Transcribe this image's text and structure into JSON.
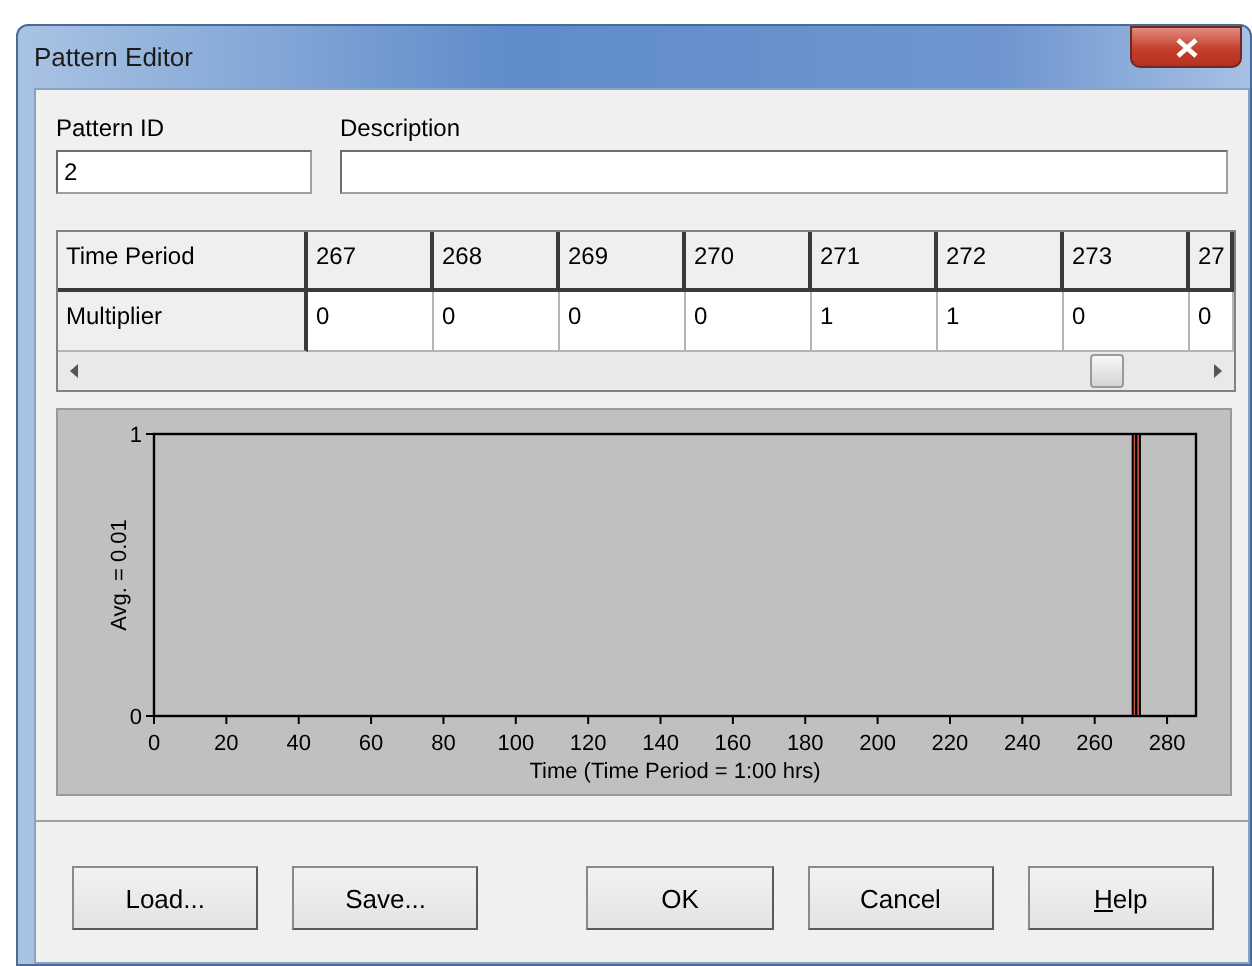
{
  "window": {
    "title": "Pattern Editor"
  },
  "pattern_id": {
    "label": "Pattern ID",
    "value": "2"
  },
  "description": {
    "label": "Description"
  },
  "grid": {
    "row_labels": [
      "Time Period",
      "Multiplier"
    ],
    "periods": [
      "267",
      "268",
      "269",
      "270",
      "271",
      "272",
      "273",
      "27"
    ],
    "multipliers": [
      "0",
      "0",
      "0",
      "0",
      "1",
      "1",
      "0",
      "0"
    ]
  },
  "chart": {
    "chart_data": {
      "type": "bar",
      "xlabel": "Time (Time Period = 1:00 hrs)",
      "ylabel": "Avg. = 0.01",
      "x": [
        271,
        272
      ],
      "series": [
        {
          "color": "#c8553d",
          "values": [
            1,
            1
          ]
        }
      ],
      "xlim": [
        0,
        288
      ],
      "ylim": [
        0,
        1
      ],
      "xticks": [
        0,
        20,
        40,
        60,
        80,
        100,
        120,
        140,
        160,
        180,
        200,
        220,
        240,
        260,
        280
      ],
      "yticks": [
        0,
        1
      ]
    }
  },
  "buttons": [
    {
      "label": "Load..."
    },
    {
      "label": "Save..."
    },
    {
      "label": "OK"
    },
    {
      "label": "Cancel"
    },
    {
      "label": "Help",
      "underline_first": true
    }
  ]
}
